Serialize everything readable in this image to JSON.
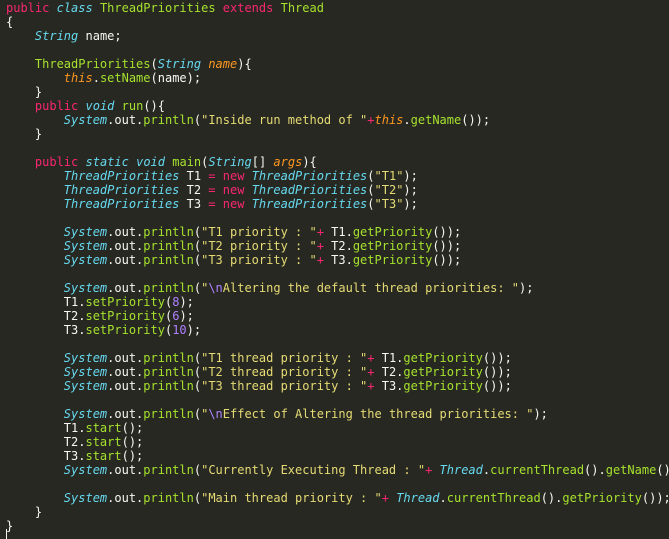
{
  "editor": {
    "theme_colors": {
      "background": "#272822",
      "keyword": "#f92672",
      "storage_type": "#66d9ef",
      "class_name": "#a6e22e",
      "parameter": "#fd971f",
      "string": "#e6db74",
      "number": "#ae81ff",
      "text": "#f8f8f2"
    },
    "lines": [
      [
        [
          "kw",
          "public"
        ],
        [
          "tx",
          " "
        ],
        [
          "st",
          "class"
        ],
        [
          "tx",
          " "
        ],
        [
          "cl",
          "ThreadPriorities"
        ],
        [
          "tx",
          " "
        ],
        [
          "kw",
          "extends"
        ],
        [
          "tx",
          " "
        ],
        [
          "cl",
          "Thread"
        ]
      ],
      [
        [
          "tx",
          "{"
        ]
      ],
      [
        [
          "tx",
          "    "
        ],
        [
          "ty",
          "String"
        ],
        [
          "tx",
          " name;"
        ]
      ],
      [
        [
          "tx",
          ""
        ]
      ],
      [
        [
          "tx",
          "    "
        ],
        [
          "fn",
          "ThreadPriorities"
        ],
        [
          "tx",
          "("
        ],
        [
          "ty",
          "String"
        ],
        [
          "tx",
          " "
        ],
        [
          "pa",
          "name"
        ],
        [
          "tx",
          "){"
        ]
      ],
      [
        [
          "tx",
          "        "
        ],
        [
          "pa",
          "this"
        ],
        [
          "tx",
          "."
        ],
        [
          "fn",
          "setName"
        ],
        [
          "tx",
          "(name);"
        ]
      ],
      [
        [
          "tx",
          "    }"
        ]
      ],
      [
        [
          "tx",
          "    "
        ],
        [
          "kw",
          "public"
        ],
        [
          "tx",
          " "
        ],
        [
          "st",
          "void"
        ],
        [
          "tx",
          " "
        ],
        [
          "fn",
          "run"
        ],
        [
          "tx",
          "(){"
        ]
      ],
      [
        [
          "tx",
          "        "
        ],
        [
          "ty",
          "System"
        ],
        [
          "tx",
          ".out."
        ],
        [
          "fn",
          "println"
        ],
        [
          "tx",
          "("
        ],
        [
          "str",
          "\"Inside run method of \""
        ],
        [
          "kw",
          "+"
        ],
        [
          "pa",
          "this"
        ],
        [
          "tx",
          "."
        ],
        [
          "fn",
          "getName"
        ],
        [
          "tx",
          "());"
        ]
      ],
      [
        [
          "tx",
          "    }"
        ]
      ],
      [
        [
          "tx",
          ""
        ]
      ],
      [
        [
          "tx",
          "    "
        ],
        [
          "kw",
          "public"
        ],
        [
          "tx",
          " "
        ],
        [
          "st",
          "static"
        ],
        [
          "tx",
          " "
        ],
        [
          "st",
          "void"
        ],
        [
          "tx",
          " "
        ],
        [
          "fn",
          "main"
        ],
        [
          "tx",
          "("
        ],
        [
          "ty",
          "String"
        ],
        [
          "tx",
          "[] "
        ],
        [
          "pa",
          "args"
        ],
        [
          "tx",
          "){"
        ]
      ],
      [
        [
          "tx",
          "        "
        ],
        [
          "ty",
          "ThreadPriorities"
        ],
        [
          "tx",
          " T1 "
        ],
        [
          "kw",
          "="
        ],
        [
          "tx",
          " "
        ],
        [
          "kw",
          "new"
        ],
        [
          "tx",
          " "
        ],
        [
          "ty",
          "ThreadPriorities"
        ],
        [
          "tx",
          "("
        ],
        [
          "str",
          "\"T1\""
        ],
        [
          "tx",
          ");"
        ]
      ],
      [
        [
          "tx",
          "        "
        ],
        [
          "ty",
          "ThreadPriorities"
        ],
        [
          "tx",
          " T2 "
        ],
        [
          "kw",
          "="
        ],
        [
          "tx",
          " "
        ],
        [
          "kw",
          "new"
        ],
        [
          "tx",
          " "
        ],
        [
          "ty",
          "ThreadPriorities"
        ],
        [
          "tx",
          "("
        ],
        [
          "str",
          "\"T2\""
        ],
        [
          "tx",
          ");"
        ]
      ],
      [
        [
          "tx",
          "        "
        ],
        [
          "ty",
          "ThreadPriorities"
        ],
        [
          "tx",
          " T3 "
        ],
        [
          "kw",
          "="
        ],
        [
          "tx",
          " "
        ],
        [
          "kw",
          "new"
        ],
        [
          "tx",
          " "
        ],
        [
          "ty",
          "ThreadPriorities"
        ],
        [
          "tx",
          "("
        ],
        [
          "str",
          "\"T3\""
        ],
        [
          "tx",
          ");"
        ]
      ],
      [
        [
          "tx",
          ""
        ]
      ],
      [
        [
          "tx",
          "        "
        ],
        [
          "ty",
          "System"
        ],
        [
          "tx",
          ".out."
        ],
        [
          "fn",
          "println"
        ],
        [
          "tx",
          "("
        ],
        [
          "str",
          "\"T1 priority : \""
        ],
        [
          "kw",
          "+"
        ],
        [
          "tx",
          " T1."
        ],
        [
          "fn",
          "getPriority"
        ],
        [
          "tx",
          "());"
        ]
      ],
      [
        [
          "tx",
          "        "
        ],
        [
          "ty",
          "System"
        ],
        [
          "tx",
          ".out."
        ],
        [
          "fn",
          "println"
        ],
        [
          "tx",
          "("
        ],
        [
          "str",
          "\"T2 priority : \""
        ],
        [
          "kw",
          "+"
        ],
        [
          "tx",
          " T2."
        ],
        [
          "fn",
          "getPriority"
        ],
        [
          "tx",
          "());"
        ]
      ],
      [
        [
          "tx",
          "        "
        ],
        [
          "ty",
          "System"
        ],
        [
          "tx",
          ".out."
        ],
        [
          "fn",
          "println"
        ],
        [
          "tx",
          "("
        ],
        [
          "str",
          "\"T3 priority : \""
        ],
        [
          "kw",
          "+"
        ],
        [
          "tx",
          " T3."
        ],
        [
          "fn",
          "getPriority"
        ],
        [
          "tx",
          "());"
        ]
      ],
      [
        [
          "tx",
          ""
        ]
      ],
      [
        [
          "tx",
          "        "
        ],
        [
          "ty",
          "System"
        ],
        [
          "tx",
          ".out."
        ],
        [
          "fn",
          "println"
        ],
        [
          "tx",
          "("
        ],
        [
          "str",
          "\""
        ],
        [
          "esc",
          "\\n"
        ],
        [
          "str",
          "Altering the default thread priorities: \""
        ],
        [
          "tx",
          ");"
        ]
      ],
      [
        [
          "tx",
          "        T1."
        ],
        [
          "fn",
          "setPriority"
        ],
        [
          "tx",
          "("
        ],
        [
          "num",
          "8"
        ],
        [
          "tx",
          ");"
        ]
      ],
      [
        [
          "tx",
          "        T2."
        ],
        [
          "fn",
          "setPriority"
        ],
        [
          "tx",
          "("
        ],
        [
          "num",
          "6"
        ],
        [
          "tx",
          ");"
        ]
      ],
      [
        [
          "tx",
          "        T3."
        ],
        [
          "fn",
          "setPriority"
        ],
        [
          "tx",
          "("
        ],
        [
          "num",
          "10"
        ],
        [
          "tx",
          ");"
        ]
      ],
      [
        [
          "tx",
          ""
        ]
      ],
      [
        [
          "tx",
          "        "
        ],
        [
          "ty",
          "System"
        ],
        [
          "tx",
          ".out."
        ],
        [
          "fn",
          "println"
        ],
        [
          "tx",
          "("
        ],
        [
          "str",
          "\"T1 thread priority : \""
        ],
        [
          "kw",
          "+"
        ],
        [
          "tx",
          " T1."
        ],
        [
          "fn",
          "getPriority"
        ],
        [
          "tx",
          "());"
        ]
      ],
      [
        [
          "tx",
          "        "
        ],
        [
          "ty",
          "System"
        ],
        [
          "tx",
          ".out."
        ],
        [
          "fn",
          "println"
        ],
        [
          "tx",
          "("
        ],
        [
          "str",
          "\"T2 thread priority : \""
        ],
        [
          "kw",
          "+"
        ],
        [
          "tx",
          " T2."
        ],
        [
          "fn",
          "getPriority"
        ],
        [
          "tx",
          "());"
        ]
      ],
      [
        [
          "tx",
          "        "
        ],
        [
          "ty",
          "System"
        ],
        [
          "tx",
          ".out."
        ],
        [
          "fn",
          "println"
        ],
        [
          "tx",
          "("
        ],
        [
          "str",
          "\"T3 thread priority : \""
        ],
        [
          "kw",
          "+"
        ],
        [
          "tx",
          " T3."
        ],
        [
          "fn",
          "getPriority"
        ],
        [
          "tx",
          "());"
        ]
      ],
      [
        [
          "tx",
          ""
        ]
      ],
      [
        [
          "tx",
          "        "
        ],
        [
          "ty",
          "System"
        ],
        [
          "tx",
          ".out."
        ],
        [
          "fn",
          "println"
        ],
        [
          "tx",
          "("
        ],
        [
          "str",
          "\""
        ],
        [
          "esc",
          "\\n"
        ],
        [
          "str",
          "Effect of Altering the thread priorities: \""
        ],
        [
          "tx",
          ");"
        ]
      ],
      [
        [
          "tx",
          "        T1."
        ],
        [
          "fn",
          "start"
        ],
        [
          "tx",
          "();"
        ]
      ],
      [
        [
          "tx",
          "        T2."
        ],
        [
          "fn",
          "start"
        ],
        [
          "tx",
          "();"
        ]
      ],
      [
        [
          "tx",
          "        T3."
        ],
        [
          "fn",
          "start"
        ],
        [
          "tx",
          "();"
        ]
      ],
      [
        [
          "tx",
          "        "
        ],
        [
          "ty",
          "System"
        ],
        [
          "tx",
          ".out."
        ],
        [
          "fn",
          "println"
        ],
        [
          "tx",
          "("
        ],
        [
          "str",
          "\"Currently Executing Thread : \""
        ],
        [
          "kw",
          "+"
        ],
        [
          "tx",
          " "
        ],
        [
          "ty",
          "Thread"
        ],
        [
          "tx",
          "."
        ],
        [
          "fn",
          "currentThread"
        ],
        [
          "tx",
          "()."
        ],
        [
          "fn",
          "getName"
        ],
        [
          "tx",
          "());"
        ]
      ],
      [
        [
          "tx",
          ""
        ]
      ],
      [
        [
          "tx",
          "        "
        ],
        [
          "ty",
          "System"
        ],
        [
          "tx",
          ".out."
        ],
        [
          "fn",
          "println"
        ],
        [
          "tx",
          "("
        ],
        [
          "str",
          "\"Main thread priority : \""
        ],
        [
          "kw",
          "+"
        ],
        [
          "tx",
          " "
        ],
        [
          "ty",
          "Thread"
        ],
        [
          "tx",
          "."
        ],
        [
          "fn",
          "currentThread"
        ],
        [
          "tx",
          "()."
        ],
        [
          "fn",
          "getPriority"
        ],
        [
          "tx",
          "());"
        ]
      ],
      [
        [
          "tx",
          "    }"
        ]
      ],
      [
        [
          "tx",
          "}"
        ]
      ]
    ]
  }
}
